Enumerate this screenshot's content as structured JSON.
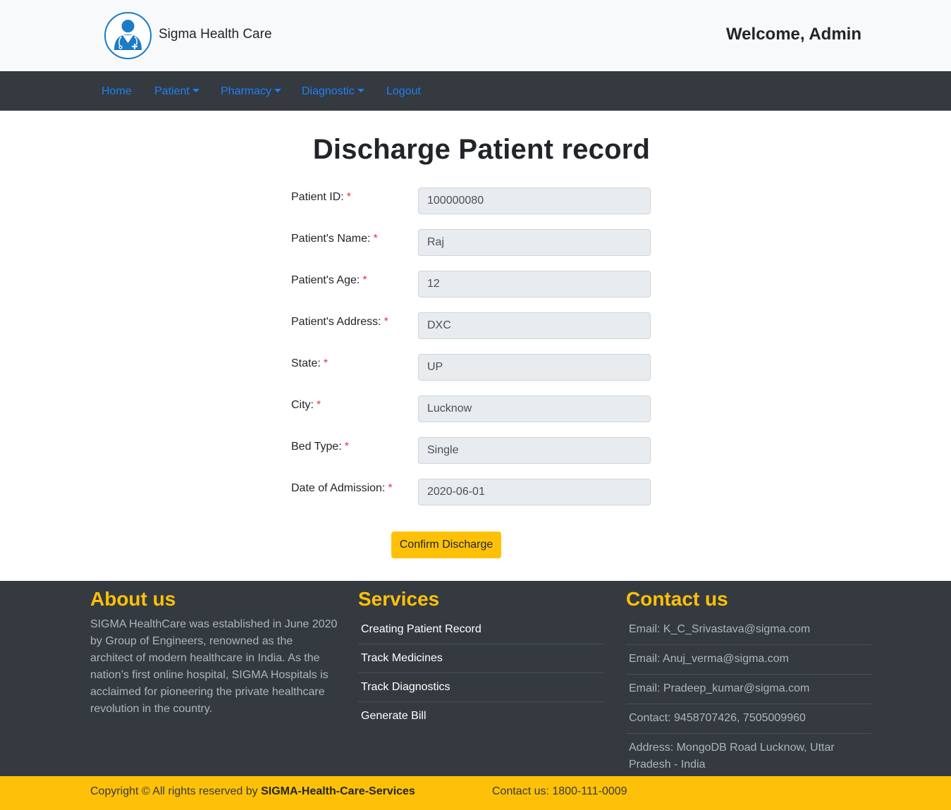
{
  "header": {
    "brand": "Sigma Health Care",
    "welcome": "Welcome, Admin",
    "logo_icon": "doctor-avatar-icon"
  },
  "nav": {
    "home": "Home",
    "patient": "Patient",
    "pharmacy": "Pharmacy",
    "diagnostic": "Diagnostic",
    "logout": "Logout"
  },
  "main": {
    "title": "Discharge Patient record",
    "fields": [
      {
        "label": "Patient ID:",
        "value": "100000080"
      },
      {
        "label": "Patient's Name:",
        "value": "Raj"
      },
      {
        "label": "Patient's Age:",
        "value": "12"
      },
      {
        "label": "Patient's Address:",
        "value": "DXC"
      },
      {
        "label": "State:",
        "value": "UP"
      },
      {
        "label": "City:",
        "value": "Lucknow"
      },
      {
        "label": "Bed Type:",
        "value": "Single"
      },
      {
        "label": "Date of Admission:",
        "value": "2020-06-01"
      }
    ],
    "required_mark": "*",
    "confirm_label": "Confirm Discharge"
  },
  "footer": {
    "about_heading": "About us",
    "about_text": "SIGMA HealthCare was established in June 2020 by Group of Engineers, renowned as the architect of modern healthcare in India. As the nation’s first online hospital, SIGMA Hospitals is acclaimed for pioneering the private healthcare revolution in the country.",
    "services_heading": "Services",
    "services": [
      "Creating Patient Record",
      "Track Medicines",
      "Track Diagnostics",
      "Generate Bill"
    ],
    "contact_heading": "Contact us",
    "contacts": [
      "Email: K_C_Srivastava@sigma.com",
      "Email: Anuj_verma@sigma.com",
      "Email: Pradeep_kumar@sigma.com",
      "Contact: 9458707426, 7505009960",
      "Address: MongoDB Road Lucknow, Uttar Pradesh - India"
    ]
  },
  "copyright": {
    "prefix": "Copyright © All rights reserved by ",
    "company": "SIGMA-Health-Care-Services",
    "contact": "Contact us: 1800-111-0009"
  },
  "colors": {
    "accent": "#ffc107",
    "nav_bg": "#343a40",
    "link": "#1f7ff7",
    "required": "#dc3545"
  }
}
